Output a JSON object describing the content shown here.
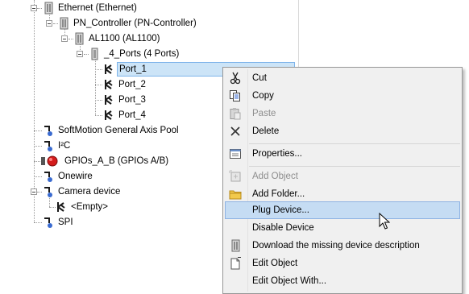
{
  "tree": {
    "items": [
      {
        "label": "Ethernet (Ethernet)",
        "icon": "device-icon"
      },
      {
        "label": "PN_Controller (PN-Controller)",
        "icon": "device-icon"
      },
      {
        "label": "AL1100 (AL1100)",
        "icon": "device-icon"
      },
      {
        "label": "_4_Ports (4 Ports)",
        "icon": "device-icon"
      },
      {
        "label": "Port_1",
        "icon": "port-icon",
        "selected": true
      },
      {
        "label": "Port_2",
        "icon": "port-icon"
      },
      {
        "label": "Port_3",
        "icon": "port-icon"
      },
      {
        "label": "Port_4",
        "icon": "port-icon"
      },
      {
        "label": "SoftMotion General Axis Pool",
        "icon": "axis-icon"
      },
      {
        "label": "I²C",
        "icon": "axis-icon"
      },
      {
        "label": "GPIOs_A_B (GPIOs A/B)",
        "icon": "gpio-icon"
      },
      {
        "label": "Onewire",
        "icon": "axis-icon"
      },
      {
        "label": "Camera device",
        "icon": "axis-icon"
      },
      {
        "label": "<Empty>",
        "icon": "port-icon"
      },
      {
        "label": "SPI",
        "icon": "axis-icon"
      }
    ]
  },
  "context_menu": {
    "items": [
      {
        "label": "Cut",
        "icon": "scissors-icon",
        "disabled": false
      },
      {
        "label": "Copy",
        "icon": "copy-icon",
        "disabled": false
      },
      {
        "label": "Paste",
        "icon": "paste-icon",
        "disabled": true
      },
      {
        "label": "Delete",
        "icon": "delete-icon",
        "disabled": false
      },
      {
        "label": "Properties...",
        "icon": "properties-icon",
        "disabled": false
      },
      {
        "label": "Add Object",
        "icon": "add-object-icon",
        "disabled": true
      },
      {
        "label": "Add Folder...",
        "icon": "folder-icon",
        "disabled": false
      },
      {
        "label": "Plug Device...",
        "icon": "",
        "disabled": false,
        "hovered": true
      },
      {
        "label": "Disable Device",
        "icon": "",
        "disabled": false
      },
      {
        "label": "Download the missing device description",
        "icon": "device-icon",
        "disabled": false
      },
      {
        "label": "Edit Object",
        "icon": "edit-object-icon",
        "disabled": false
      },
      {
        "label": "Edit Object With...",
        "icon": "",
        "disabled": false
      }
    ]
  },
  "colors": {
    "selection": "#cce4f7",
    "menu_hover": "#c5dcf3",
    "menu_background": "#f0f0f0"
  }
}
